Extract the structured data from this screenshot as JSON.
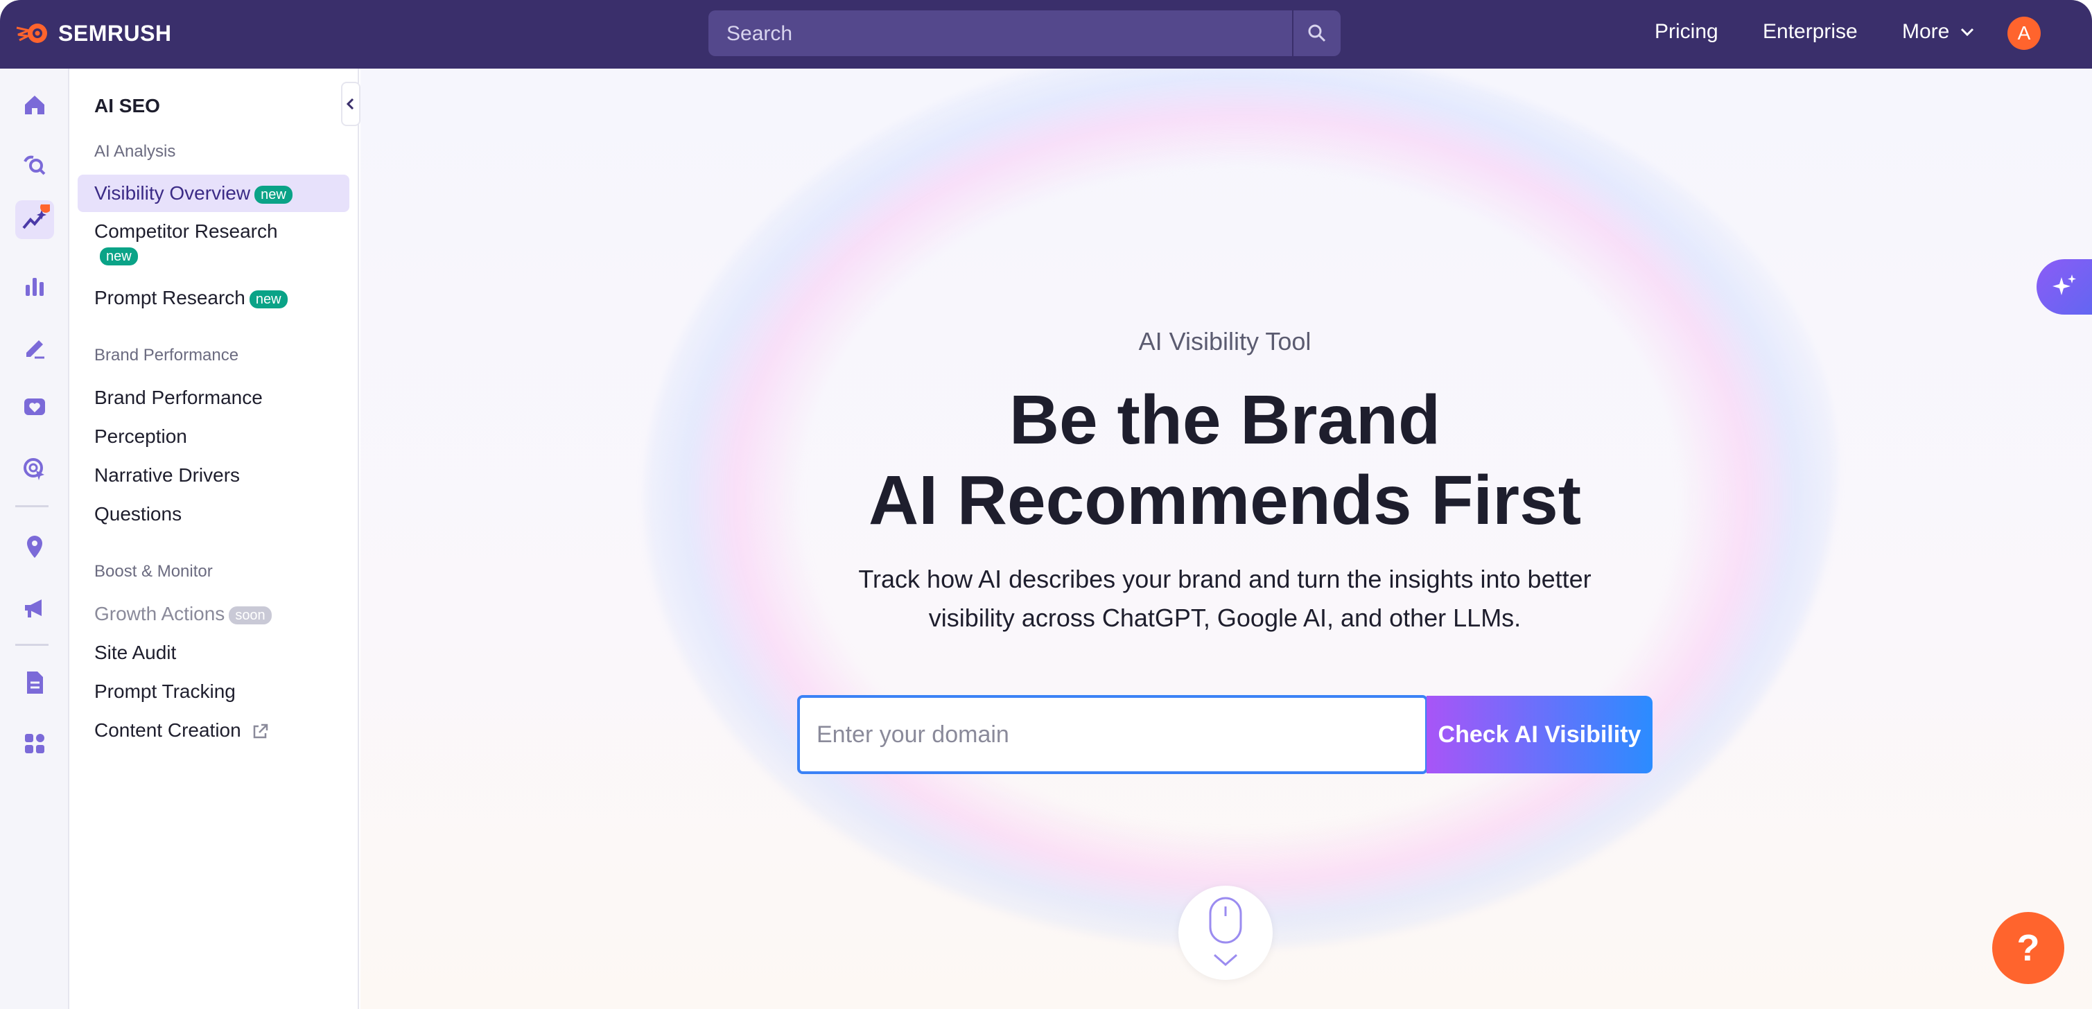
{
  "header": {
    "brand": "SEMRUSH",
    "search_placeholder": "Search",
    "nav": [
      "Pricing",
      "Enterprise",
      "More"
    ],
    "avatar_initial": "A"
  },
  "sidebar": {
    "title": "AI SEO",
    "sections": [
      {
        "label": "AI Analysis",
        "items": [
          {
            "label": "Visibility Overview",
            "badge": "new"
          },
          {
            "label": "Competitor Research",
            "badge": "new"
          },
          {
            "label": "Prompt Research",
            "badge": "new"
          }
        ]
      },
      {
        "label": "Brand Performance",
        "items": [
          {
            "label": "Brand Performance"
          },
          {
            "label": "Perception"
          },
          {
            "label": "Narrative Drivers"
          },
          {
            "label": "Questions"
          }
        ]
      },
      {
        "label": "Boost & Monitor",
        "items": [
          {
            "label": "Growth Actions",
            "badge": "soon"
          },
          {
            "label": "Site Audit"
          },
          {
            "label": "Prompt Tracking"
          },
          {
            "label": "Content Creation"
          }
        ]
      }
    ]
  },
  "hero": {
    "eyebrow": "AI Visibility Tool",
    "headline_line1": "Be the Brand",
    "headline_line2": "AI Recommends First",
    "subtitle_line1": "Track how AI describes your brand and turn the insights into better",
    "subtitle_line2": "visibility across ChatGPT, Google AI, and other LLMs.",
    "input_placeholder": "Enter your domain",
    "input_value": "",
    "button_label": "Check AI Visibility"
  },
  "help_label": "?",
  "colors": {
    "topbar": "#3a2f6b",
    "accent_orange": "#ff642d",
    "active_bg": "#e7e1fb",
    "badge_new": "#0aa387"
  }
}
